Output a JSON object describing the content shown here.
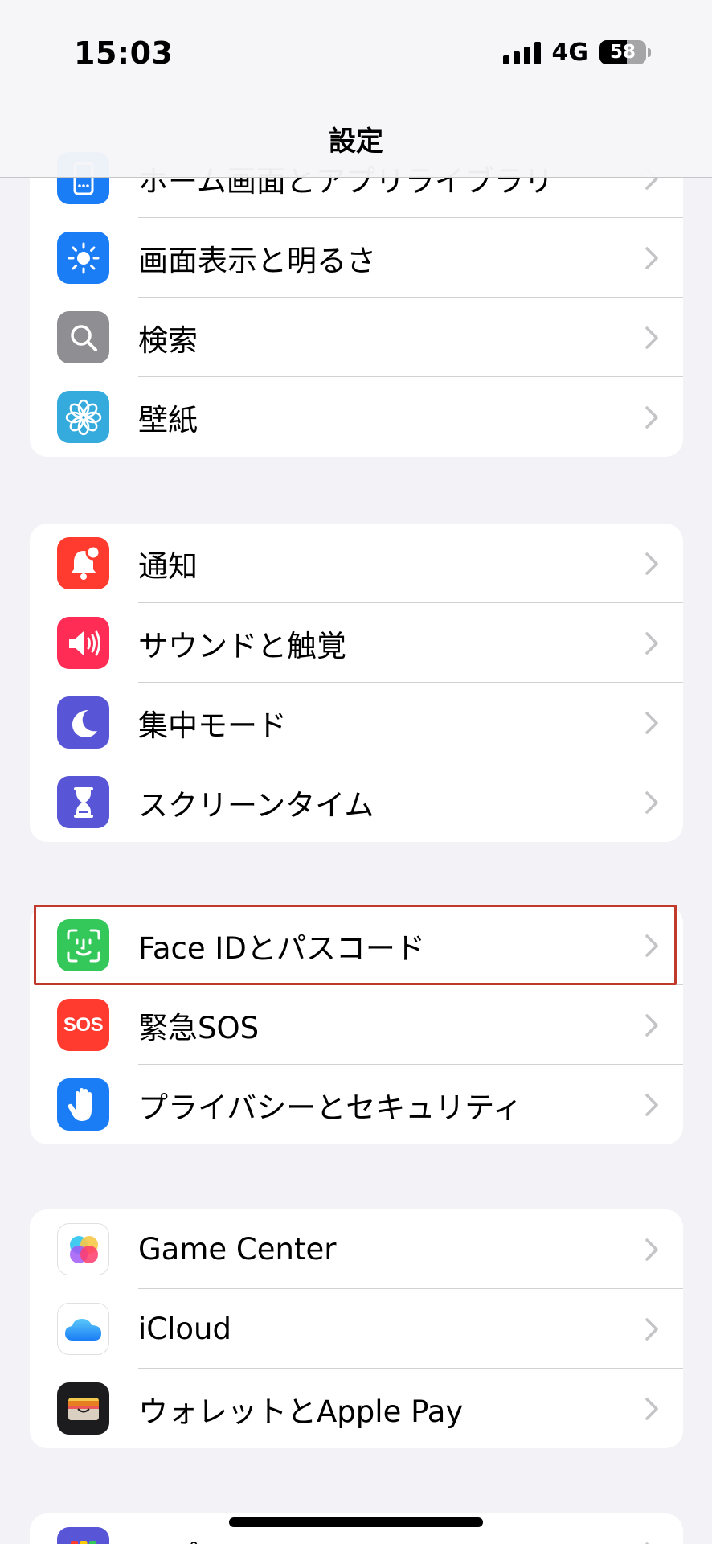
{
  "status_bar": {
    "time": "15:03",
    "network": "4G",
    "battery": "58",
    "battery_level": 0.58
  },
  "nav": {
    "title": "設定"
  },
  "groups": [
    {
      "rows": [
        {
          "label": "ホーム画面とアプリライブラリ",
          "icon": "home-screen-icon",
          "color": "#1a7df5"
        },
        {
          "label": "画面表示と明るさ",
          "icon": "brightness-icon",
          "color": "#1a7df5"
        },
        {
          "label": "検索",
          "icon": "search-icon",
          "color": "#8e8e93"
        },
        {
          "label": "壁紙",
          "icon": "wallpaper-flower-icon",
          "color": "#35aadc"
        }
      ]
    },
    {
      "rows": [
        {
          "label": "通知",
          "icon": "notification-bell-icon",
          "color": "#ff3b30"
        },
        {
          "label": "サウンドと触覚",
          "icon": "speaker-icon",
          "color": "#ff2d55"
        },
        {
          "label": "集中モード",
          "icon": "moon-icon",
          "color": "#5856d6"
        },
        {
          "label": "スクリーンタイム",
          "icon": "hourglass-icon",
          "color": "#5856d6"
        }
      ]
    },
    {
      "rows": [
        {
          "label": "Face IDとパスコード",
          "icon": "face-id-icon",
          "color": "#34c759"
        },
        {
          "label": "緊急SOS",
          "icon": "sos-icon",
          "color": "#ff3b30",
          "icon_text": "SOS"
        },
        {
          "label": "プライバシーとセキュリティ",
          "icon": "hand-icon",
          "color": "#1a7df5"
        }
      ]
    },
    {
      "rows": [
        {
          "label": "Game Center",
          "icon": "game-center-icon",
          "color": "#ffffff"
        },
        {
          "label": "iCloud",
          "icon": "icloud-icon",
          "color": "#ffffff"
        },
        {
          "label": "ウォレットとApple Pay",
          "icon": "wallet-icon",
          "color": "#1c1c1e"
        }
      ]
    },
    {
      "rows": [
        {
          "label": "アプリ",
          "icon": "apps-grid-icon",
          "color": "#5856d6"
        }
      ]
    }
  ]
}
